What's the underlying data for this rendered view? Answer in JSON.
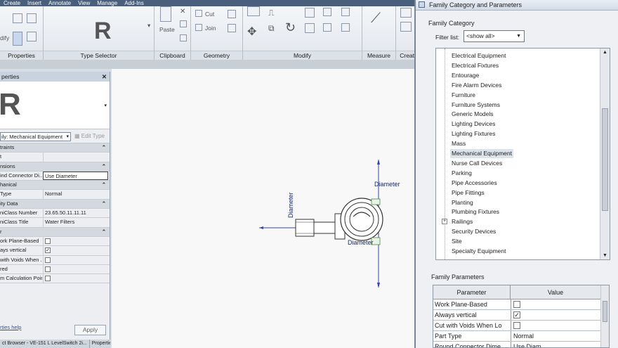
{
  "menubar": {
    "tabs": [
      "Create",
      "Insert",
      "Annotate",
      "View",
      "Manage",
      "Add-Ins"
    ]
  },
  "ribbon": {
    "panels": {
      "properties": "Properties",
      "type_selector": "Type Selector",
      "clipboard": "Clipboard",
      "geometry": "Geometry",
      "modify": "Modify",
      "measure": "Measure",
      "create": "Create"
    },
    "logo": "R",
    "paste": "Paste",
    "cut": "Cut",
    "join": "Join",
    "edit_mode": "dify"
  },
  "properties_palette": {
    "title": "perties",
    "family": "ily: Mechanical Equipment",
    "edit_type": "Edit Type",
    "rows": [
      {
        "type": "group",
        "name": "traints"
      },
      {
        "type": "row",
        "name": "t",
        "value": ""
      },
      {
        "type": "group",
        "name": "nsions"
      },
      {
        "type": "row",
        "name": "ind Connector Di...",
        "value": "Use Diameter",
        "boxed": true
      },
      {
        "type": "group",
        "name": "hanical"
      },
      {
        "type": "row",
        "name": "Type",
        "value": "Normal"
      },
      {
        "type": "group",
        "name": "ity Data"
      },
      {
        "type": "row",
        "name": "niClass Number",
        "value": "23.65.50.11.11.11"
      },
      {
        "type": "row",
        "name": "niClass Title",
        "value": "Water Filters"
      },
      {
        "type": "group",
        "name": "r"
      },
      {
        "type": "check",
        "name": "ork Plane-Based",
        "checked": false
      },
      {
        "type": "check",
        "name": "ays vertical",
        "checked": true
      },
      {
        "type": "check",
        "name": "with Voids When ...",
        "checked": false
      },
      {
        "type": "check",
        "name": "red",
        "checked": false
      },
      {
        "type": "check",
        "name": "m Calculation Point",
        "checked": false
      }
    ],
    "help_link": "rties help",
    "apply": "Apply",
    "bottom_tabs": [
      "ct Browser - VE-151 L LevelSwitch 2i...",
      "Properties"
    ]
  },
  "canvas": {
    "labels": {
      "diameter_vertical": "Diameter",
      "diameter_top": "Diameter",
      "diameter_bottom": "Diameter"
    }
  },
  "dialog": {
    "title": "Family Category and Parameters",
    "category_group": "Family Category",
    "filter_label": "Filter list:",
    "filter_value": "<show all>",
    "categories": [
      "Electrical Equipment",
      "Electrical Fixtures",
      "Entourage",
      "Fire Alarm Devices",
      "Furniture",
      "Furniture Systems",
      "Generic Models",
      "Lighting Devices",
      "Lighting Fixtures",
      "Mass",
      "Mechanical Equipment",
      "Nurse Call Devices",
      "Parking",
      "Pipe Accessories",
      "Pipe Fittings",
      "Planting",
      "Plumbing Fixtures",
      "Railings",
      "Security Devices",
      "Site",
      "Specialty Equipment"
    ],
    "selected_category": "Mechanical Equipment",
    "expandable_category": "Railings",
    "params_group": "Family Parameters",
    "params_header": {
      "parameter": "Parameter",
      "value": "Value"
    },
    "params": [
      {
        "name": "Work Plane-Based",
        "kind": "check",
        "checked": false
      },
      {
        "name": "Always vertical",
        "kind": "check",
        "checked": true
      },
      {
        "name": "Cut with Voids When Lo",
        "kind": "check",
        "checked": false
      },
      {
        "name": "Part Type",
        "kind": "text",
        "value": "Normal"
      },
      {
        "name": "Round Connector Dime",
        "kind": "text",
        "value": "Use Diam"
      }
    ]
  }
}
